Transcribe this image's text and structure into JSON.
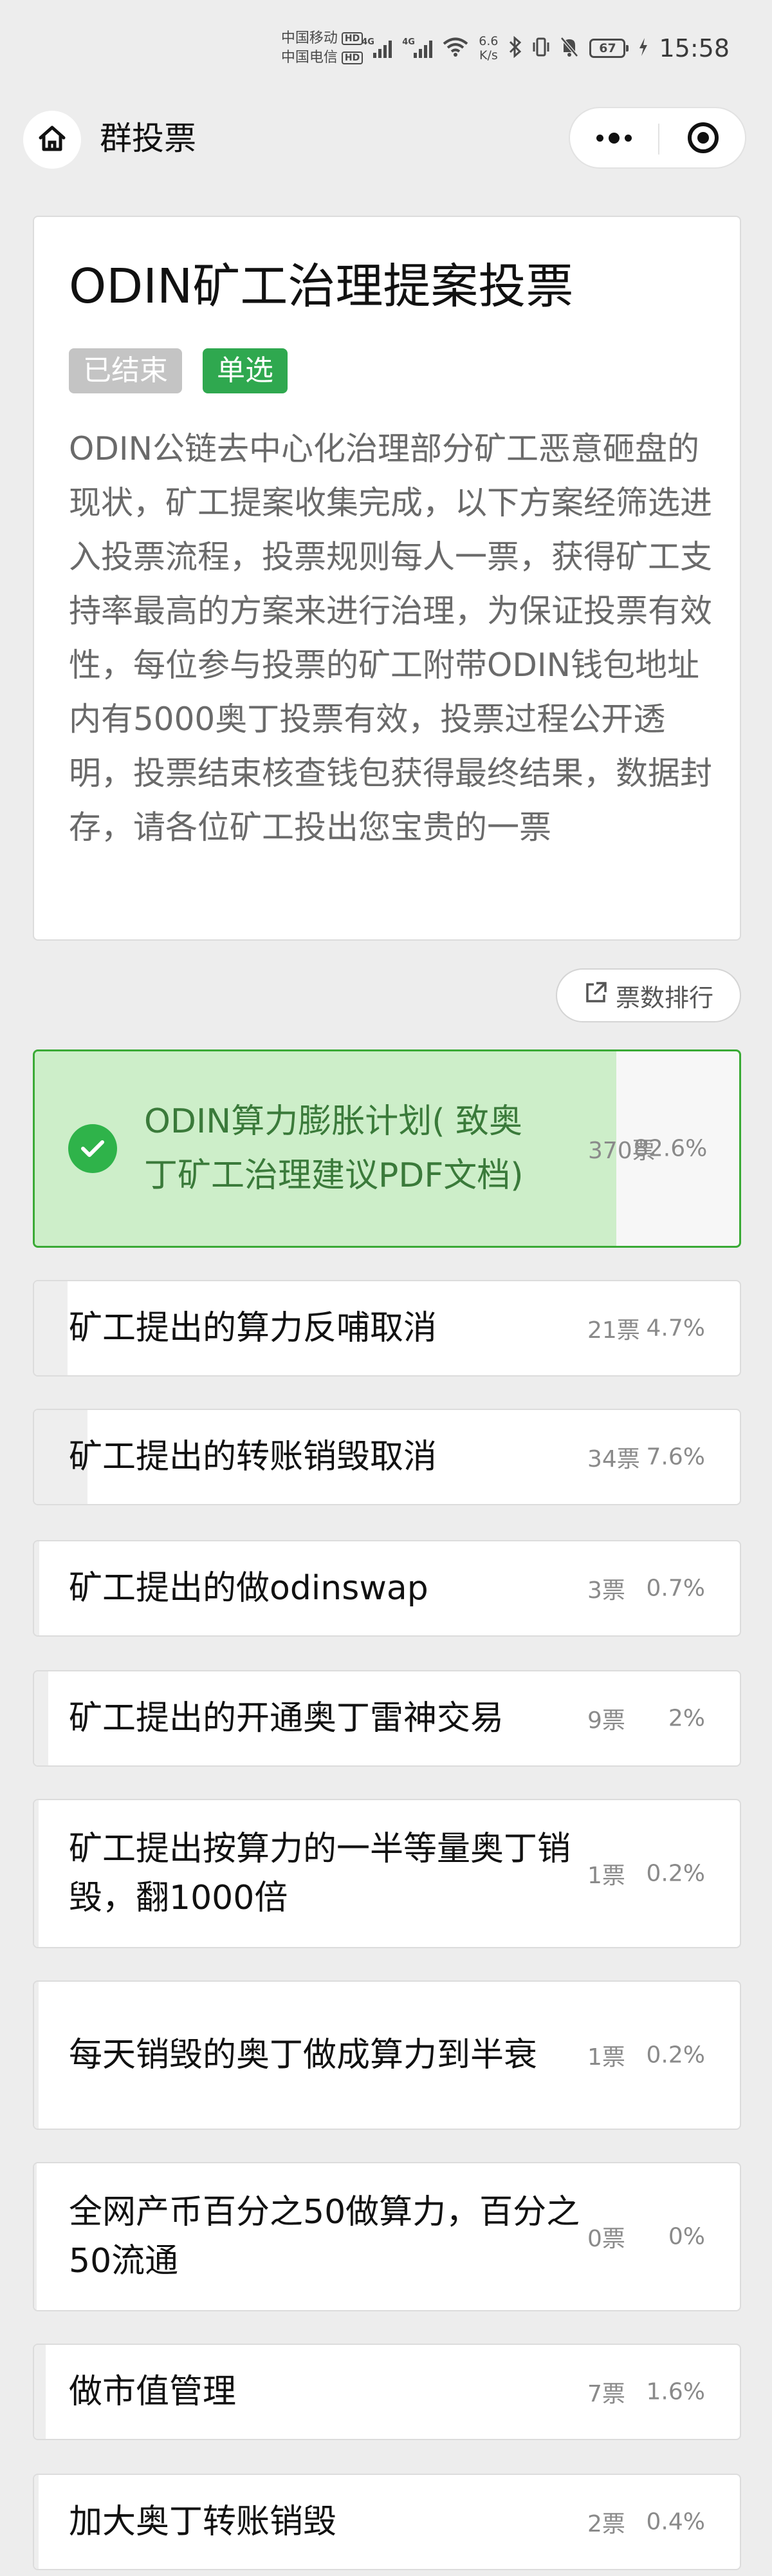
{
  "status_bar": {
    "carrier1": "中国移动",
    "carrier2": "中国电信",
    "hd": "HD",
    "net_type": "4G",
    "speed_value": "6.6",
    "speed_unit": "K/s",
    "battery": "67",
    "time": "15:58"
  },
  "nav": {
    "title": "群投票"
  },
  "poll": {
    "title": "ODIN矿工治理提案投票",
    "tag_status": "已结束",
    "tag_type": "单选",
    "description": "ODIN公链去中心化治理部分矿工恶意砸盘的现状，矿工提案收集完成，以下方案经筛选进入投票流程，投票规则每人一票，获得矿工支持率最高的方案来进行治理，为保证投票有效性，每位参与投票的矿工附带ODIN钱包地址内有5000奥丁投票有效，投票过程公开透明，投票结束核查钱包获得最终结果，数据封存，请各位矿工投出您宝贵的一票",
    "rank_button": "票数排行"
  },
  "options": [
    {
      "label": "ODIN算力膨胀计划( 致奥丁矿工治理建议PDF文档)",
      "votes": "370票",
      "percent": "82.6%",
      "share": 0.826,
      "selected": true
    },
    {
      "label": "矿工提出的算力反哺取消",
      "votes": "21票",
      "percent": "4.7%",
      "share": 0.047
    },
    {
      "label": "矿工提出的转账销毁取消",
      "votes": "34票",
      "percent": "7.6%",
      "share": 0.076
    },
    {
      "label": "矿工提出的做odinswap",
      "votes": "3票",
      "percent": "0.7%",
      "share": 0.007
    },
    {
      "label": "矿工提出的开通奥丁雷神交易",
      "votes": "9票",
      "percent": "2%",
      "share": 0.02
    },
    {
      "label": "矿工提出按算力的一半等量奥丁销毁，翻1000倍",
      "votes": "1票",
      "percent": "0.2%",
      "share": 0.002
    },
    {
      "label": "每天销毁的奥丁做成算力到半衰",
      "votes": "1票",
      "percent": "0.2%",
      "share": 0.002
    },
    {
      "label": "全网产币百分之50做算力，百分之50流通",
      "votes": "0票",
      "percent": "0%",
      "share": 0
    },
    {
      "label": "做市值管理",
      "votes": "7票",
      "percent": "1.6%",
      "share": 0.016
    },
    {
      "label": "加大奥丁转账销毁",
      "votes": "2票",
      "percent": "0.4%",
      "share": 0.004
    }
  ],
  "colors": {
    "accent_green": "#2fb34a",
    "selected_border": "#3aaa35",
    "selected_fill": "#cdeec9",
    "tag_ended": "#c4c4c4"
  }
}
